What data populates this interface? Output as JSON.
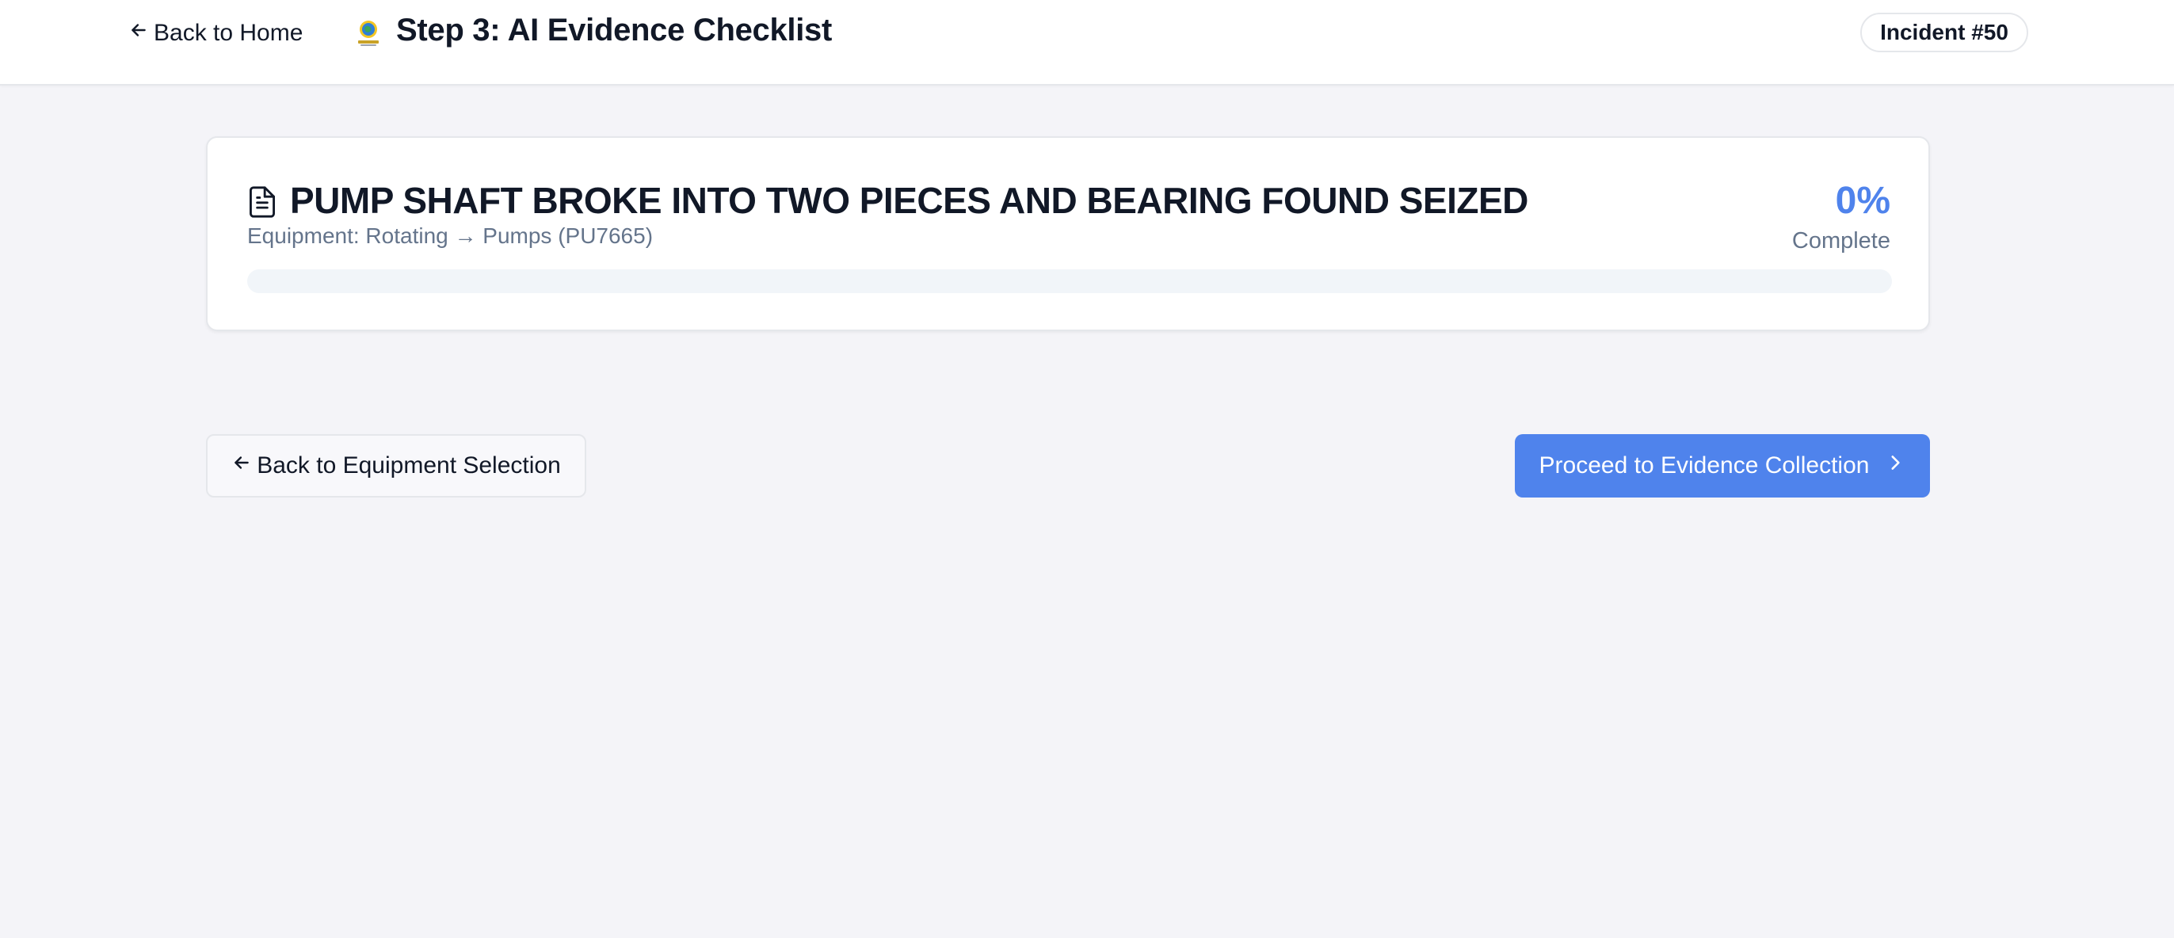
{
  "header": {
    "back_label": "Back to Home",
    "title": "Step 3: AI Evidence Checklist",
    "incident_badge": "Incident #50"
  },
  "incident_card": {
    "title": "PUMP SHAFT BROKE INTO TWO PIECES AND BEARING FOUND SEIZED",
    "equipment_path": "Equipment: Rotating → Pumps (PU7665)",
    "progress_percent_label": "0%",
    "progress_label": "Complete",
    "progress_value": 0
  },
  "actions": {
    "back_label": "Back to Equipment Selection",
    "proceed_label": "Proceed to Evidence Collection"
  },
  "icons": {
    "back_home": "arrow-left-icon",
    "logo": "app-logo",
    "document": "file-text-icon",
    "back_equipment": "arrow-left-icon",
    "proceed": "chevron-right-icon"
  },
  "colors": {
    "accent": "#4f83ec",
    "background": "#f4f4f8",
    "muted_text": "#64748b"
  }
}
